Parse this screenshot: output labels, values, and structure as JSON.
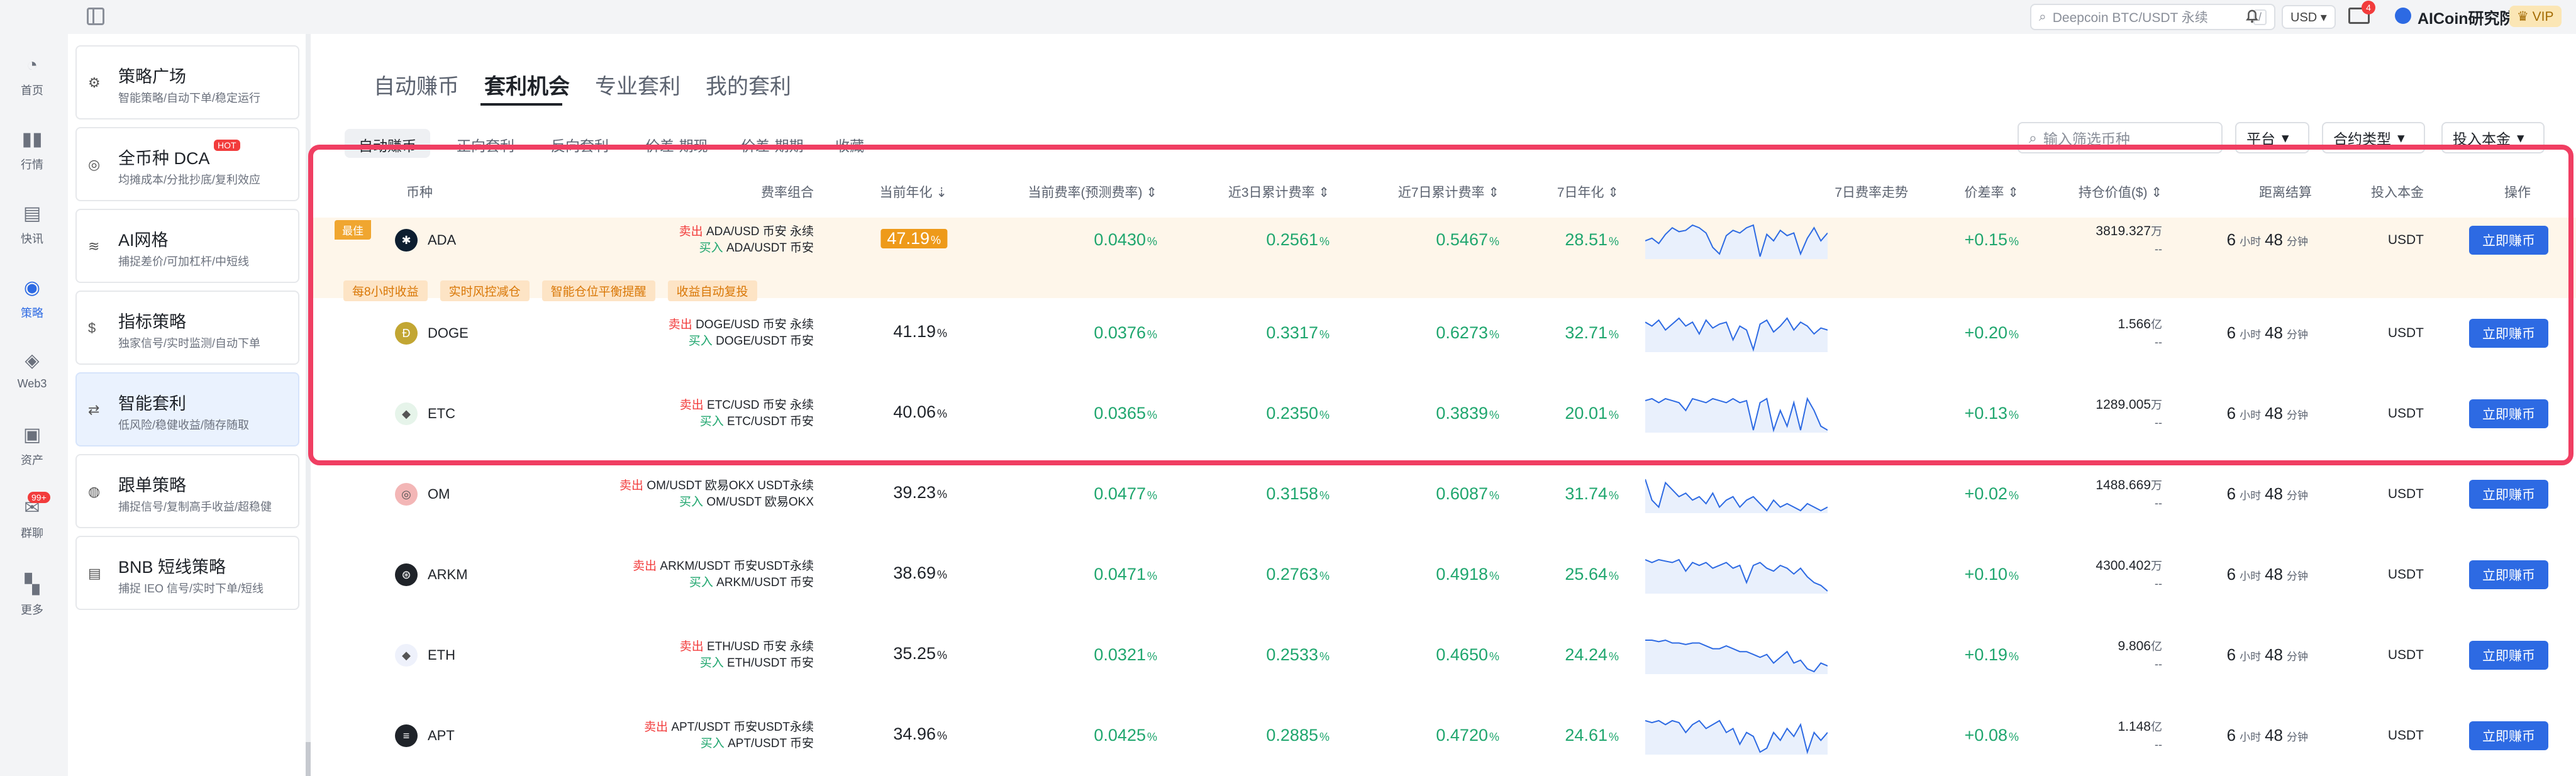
{
  "topbar": {
    "search_placeholder": "Deepcoin BTC/USDT 永续",
    "search_shortcut": "/",
    "currency": "USD ▾",
    "mail_badge": "4",
    "username": "AICoin研究院",
    "vip": "♛ VIP"
  },
  "left_nav": [
    {
      "label": "首页",
      "icon": "◔"
    },
    {
      "label": "行情",
      "icon": "▮▮"
    },
    {
      "label": "快讯",
      "icon": "▤"
    },
    {
      "label": "策略",
      "icon": "◉"
    },
    {
      "label": "Web3",
      "icon": "◈"
    },
    {
      "label": "资产",
      "icon": "▣"
    },
    {
      "label": "群聊",
      "icon": "✉",
      "badge": "99+"
    },
    {
      "label": "更多",
      "icon": "▚"
    }
  ],
  "strategy_cards": [
    {
      "title": "策略广场",
      "subtitle": "智能策略/自动下单/稳定运行",
      "icon": "⚙"
    },
    {
      "title": "全币种 DCA",
      "subtitle": "均摊成本/分批抄底/复利效应",
      "icon": "◎",
      "badge": "HOT"
    },
    {
      "title": "AI网格",
      "subtitle": "捕捉差价/可加杠杆/中短线",
      "icon": "≋"
    },
    {
      "title": "指标策略",
      "subtitle": "独家信号/实时监测/自动下单",
      "icon": "$"
    },
    {
      "title": "智能套利",
      "subtitle": "低风险/稳健收益/随存随取",
      "icon": "⇄"
    },
    {
      "title": "跟单策略",
      "subtitle": "捕捉信号/复制高手收益/超稳健",
      "icon": "◍"
    },
    {
      "title": "BNB 短线策略",
      "subtitle": "捕捉 IEO 信号/实时下单/短线",
      "icon": "▤"
    }
  ],
  "page_tabs": [
    "自动赚币",
    "套利机会",
    "专业套利",
    "我的套利"
  ],
  "sub_tabs": [
    "自动赚币",
    "正向套利",
    "反向套利",
    "价差-期现",
    "价差-期期",
    "收藏"
  ],
  "filters": {
    "search_placeholder": "输入筛选币种",
    "platform": "平台",
    "contract_type": "合约类型",
    "invest": "投入本金"
  },
  "columns": {
    "coin": "币种",
    "combo": "费率组合",
    "annual": "当前年化",
    "cur_rate": "当前费率(预测费率)",
    "rate3d": "近3日累计费率",
    "rate7d": "近7日累计费率",
    "annual7d": "7日年化",
    "trend": "7日费率走势",
    "spread": "价差率",
    "hold_value": "持仓价值($)",
    "settle": "距离结算",
    "principal": "投入本金",
    "action": "操作"
  },
  "best_tag": "最佳",
  "best_features": [
    "每8小时收益",
    "实时风控减仓",
    "智能仓位平衡提醒",
    "收益自动复投"
  ],
  "rows": [
    {
      "coin": "ADA",
      "icon_color": "#0d1e30",
      "icon_glyph": "✱",
      "sell_label": "卖出",
      "sell_pair": "ADA/USD",
      "sell_venue": "币安 永续",
      "buy_label": "买入",
      "buy_pair": "ADA/USDT",
      "buy_venue": "币安",
      "annual": "47.19",
      "cur_rate": "0.0430",
      "rate3d": "0.2561",
      "rate7d": "0.5467",
      "annual7d": "28.51",
      "trend": [
        40,
        42,
        38,
        45,
        50,
        47,
        48,
        52,
        50,
        46,
        35,
        30,
        44,
        48,
        46,
        50,
        52,
        28,
        45,
        40,
        48,
        44,
        46,
        30,
        42,
        50,
        40,
        46
      ],
      "spread": "+0.15",
      "hold_value": "3819.327",
      "hold_unit": "万",
      "hold_sub": "--",
      "hours": "6",
      "minutes": "48",
      "hour_unit": "小时",
      "minute_unit": "分钟",
      "principal": "USDT",
      "action": "立即赚币"
    },
    {
      "coin": "DOGE",
      "icon_color": "#c2a633",
      "icon_glyph": "Ð",
      "sell_label": "卖出",
      "sell_pair": "DOGE/USD",
      "sell_venue": "币安 永续",
      "buy_label": "买入",
      "buy_pair": "DOGE/USDT",
      "buy_venue": "币安",
      "annual": "41.19",
      "cur_rate": "0.0376",
      "rate3d": "0.3317",
      "rate7d": "0.6273",
      "annual7d": "32.71",
      "trend": [
        48,
        44,
        50,
        40,
        46,
        52,
        44,
        48,
        36,
        50,
        42,
        46,
        48,
        30,
        44,
        40,
        20,
        46,
        50,
        38,
        44,
        52,
        40,
        48,
        44,
        36,
        42,
        40
      ],
      "spread": "+0.20",
      "hold_value": "1.566",
      "hold_unit": "亿",
      "hold_sub": "--",
      "hours": "6",
      "minutes": "48",
      "hour_unit": "小时",
      "minute_unit": "分钟",
      "principal": "USDT",
      "action": "立即赚币"
    },
    {
      "coin": "ETC",
      "icon_color": "#e6f4ea",
      "icon_glyph": "◆",
      "sell_label": "卖出",
      "sell_pair": "ETC/USD",
      "sell_venue": "币安 永续",
      "buy_label": "买入",
      "buy_pair": "ETC/USDT",
      "buy_venue": "币安",
      "annual": "40.06",
      "cur_rate": "0.0365",
      "rate3d": "0.2350",
      "rate7d": "0.3839",
      "annual7d": "20.01",
      "trend": [
        45,
        46,
        44,
        46,
        45,
        44,
        40,
        46,
        45,
        44,
        46,
        45,
        44,
        46,
        44,
        45,
        30,
        44,
        46,
        30,
        40,
        32,
        44,
        30,
        46,
        40,
        32,
        30
      ],
      "spread": "+0.13",
      "hold_value": "1289.005",
      "hold_unit": "万",
      "hold_sub": "--",
      "hours": "6",
      "minutes": "48",
      "hour_unit": "小时",
      "minute_unit": "分钟",
      "principal": "USDT",
      "action": "立即赚币"
    },
    {
      "coin": "OM",
      "icon_color": "#f3b6b6",
      "icon_glyph": "◎",
      "sell_label": "卖出",
      "sell_pair": "OM/USDT",
      "sell_venue": "欧易OKX USDT永续",
      "buy_label": "买入",
      "buy_pair": "OM/USDT",
      "buy_venue": "欧易OKX",
      "annual": "39.23",
      "cur_rate": "0.0477",
      "rate3d": "0.3158",
      "rate7d": "0.6087",
      "annual7d": "31.74",
      "trend": [
        46,
        34,
        30,
        44,
        40,
        36,
        38,
        34,
        36,
        32,
        38,
        30,
        34,
        36,
        30,
        34,
        36,
        32,
        28,
        34,
        30,
        32,
        30,
        28,
        32,
        30,
        28,
        30
      ],
      "spread": "+0.02",
      "hold_value": "1488.669",
      "hold_unit": "万",
      "hold_sub": "--",
      "hours": "6",
      "minutes": "48",
      "hour_unit": "小时",
      "minute_unit": "分钟",
      "principal": "USDT",
      "action": "立即赚币"
    },
    {
      "coin": "ARKM",
      "icon_color": "#1f2329",
      "icon_glyph": "⊛",
      "sell_label": "卖出",
      "sell_pair": "ARKM/USDT",
      "sell_venue": "币安USDT永续",
      "buy_label": "买入",
      "buy_pair": "ARKM/USDT",
      "buy_venue": "币安",
      "annual": "38.69",
      "cur_rate": "0.0471",
      "rate3d": "0.2763",
      "rate7d": "0.4918",
      "annual7d": "25.64",
      "trend": [
        46,
        44,
        46,
        45,
        44,
        46,
        38,
        44,
        42,
        44,
        40,
        42,
        44,
        40,
        42,
        30,
        42,
        44,
        40,
        38,
        42,
        40,
        36,
        40,
        34,
        30,
        28,
        24
      ],
      "spread": "+0.10",
      "hold_value": "4300.402",
      "hold_unit": "万",
      "hold_sub": "--",
      "hours": "6",
      "minutes": "48",
      "hour_unit": "小时",
      "minute_unit": "分钟",
      "principal": "USDT",
      "action": "立即赚币"
    },
    {
      "coin": "ETH",
      "icon_color": "#eef1fb",
      "icon_glyph": "◆",
      "sell_label": "卖出",
      "sell_pair": "ETH/USD",
      "sell_venue": "币安 永续",
      "buy_label": "买入",
      "buy_pair": "ETH/USDT",
      "buy_venue": "币安",
      "annual": "35.25",
      "cur_rate": "0.0321",
      "rate3d": "0.2533",
      "rate7d": "0.4650",
      "annual7d": "24.24",
      "trend": [
        46,
        46,
        45,
        46,
        44,
        44,
        43,
        44,
        44,
        42,
        40,
        40,
        42,
        40,
        38,
        38,
        36,
        34,
        36,
        30,
        34,
        38,
        30,
        32,
        26,
        24,
        30,
        28
      ],
      "spread": "+0.19",
      "hold_value": "9.806",
      "hold_unit": "亿",
      "hold_sub": "--",
      "hours": "6",
      "minutes": "48",
      "hour_unit": "小时",
      "minute_unit": "分钟",
      "principal": "USDT",
      "action": "立即赚币"
    },
    {
      "coin": "APT",
      "icon_color": "#1f2329",
      "icon_glyph": "≡",
      "sell_label": "卖出",
      "sell_pair": "APT/USDT",
      "sell_venue": "币安USDT永续",
      "buy_label": "买入",
      "buy_pair": "APT/USDT",
      "buy_venue": "币安",
      "annual": "34.96",
      "cur_rate": "0.0425",
      "rate3d": "0.2885",
      "rate7d": "0.4720",
      "annual7d": "24.61",
      "trend": [
        46,
        45,
        46,
        44,
        46,
        45,
        40,
        44,
        46,
        42,
        44,
        46,
        40,
        42,
        34,
        40,
        38,
        30,
        32,
        40,
        36,
        42,
        38,
        44,
        30,
        40,
        36,
        40
      ],
      "spread": "+0.08",
      "hold_value": "1.148",
      "hold_unit": "亿",
      "hold_sub": "--",
      "hours": "6",
      "minutes": "48",
      "hour_unit": "小时",
      "minute_unit": "分钟",
      "principal": "USDT",
      "action": "立即赚币"
    }
  ],
  "pct_sign": "%",
  "colors": {
    "accent": "#2d6ae3",
    "green": "#1fa66e",
    "red": "#f23c3c",
    "best": "#ee9a1a",
    "highlight": "#f03e62"
  }
}
